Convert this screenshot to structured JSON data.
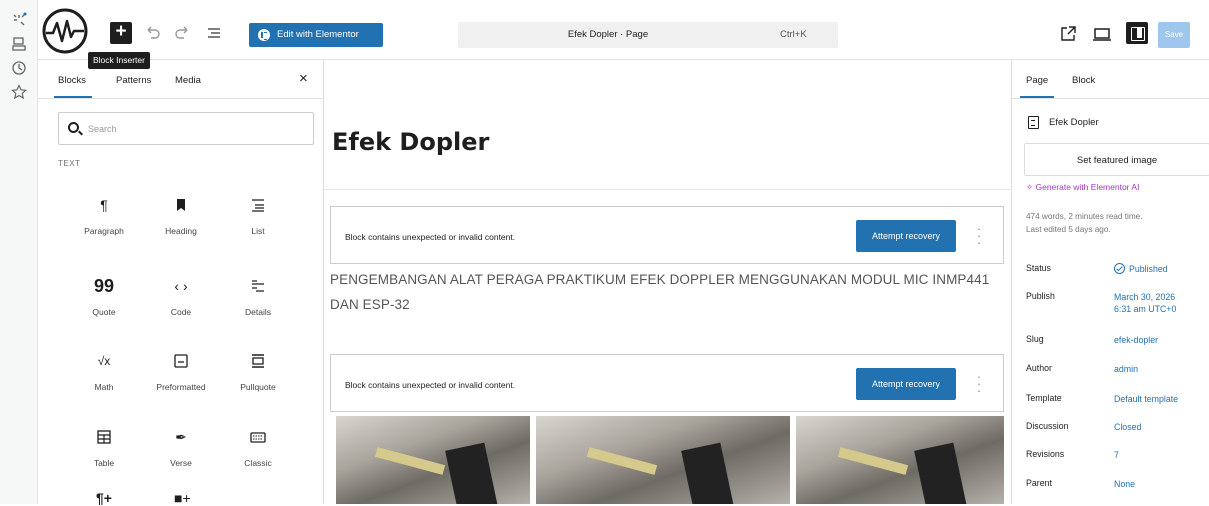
{
  "toolbar": {
    "inserter_tooltip": "Block Inserter",
    "elementor_label": "Edit with Elementor",
    "document_title": "Efek Dopler · Page",
    "shortcut": "Ctrl+K",
    "save_label": "Save"
  },
  "inserter": {
    "tabs": [
      "Blocks",
      "Patterns",
      "Media"
    ],
    "close_label": "×",
    "search_placeholder": "Search",
    "category": "TEXT",
    "blocks": [
      {
        "label": "Paragraph",
        "glyph": "¶"
      },
      {
        "label": "Heading",
        "glyph": "■"
      },
      {
        "label": "List",
        "glyph": "☰"
      },
      {
        "label": "Quote",
        "glyph": "”"
      },
      {
        "label": "Code",
        "glyph": "‹ ›"
      },
      {
        "label": "Details",
        "glyph": "≡"
      },
      {
        "label": "Math",
        "glyph": "√x"
      },
      {
        "label": "Preformatted",
        "glyph": "▣"
      },
      {
        "label": "Pullquote",
        "glyph": "☰"
      },
      {
        "label": "Table",
        "glyph": "⊞"
      },
      {
        "label": "Verse",
        "glyph": "✒"
      },
      {
        "label": "Classic",
        "glyph": "⌨"
      }
    ]
  },
  "canvas": {
    "title": "Efek Dopler",
    "invalid_message": "Block contains unexpected or invalid content.",
    "recovery_label": "Attempt recovery",
    "paragraph": "PENGEMBANGAN ALAT PERAGA PRAKTIKUM EFEK DOPPLER MENGGUNAKAN MODUL MIC INMP441 DAN ESP-32"
  },
  "sidebar": {
    "tabs": [
      "Page",
      "Block"
    ],
    "doc_name": "Efek Dopler",
    "featured_label": "Set featured image",
    "ai_label": "Generate with Elementor AI",
    "meta_words": "474 words, 2 minutes read time.",
    "meta_edited": "Last edited 5 days ago.",
    "fields": {
      "status": {
        "key": "Status",
        "value": "Published"
      },
      "publish": {
        "key": "Publish",
        "value": "March 30, 2026",
        "value2": "6:31 am UTC+0"
      },
      "slug": {
        "key": "Slug",
        "value": "efek-dopler"
      },
      "author": {
        "key": "Author",
        "value": "admin"
      },
      "template": {
        "key": "Template",
        "value": "Default template"
      },
      "discussion": {
        "key": "Discussion",
        "value": "Closed"
      },
      "revisions": {
        "key": "Revisions",
        "value": "7"
      },
      "parent": {
        "key": "Parent",
        "value": "None"
      }
    }
  },
  "colors": {
    "accent": "#2271b1",
    "ai": "#a635c7",
    "save_disabled": "#9fc6ec"
  }
}
